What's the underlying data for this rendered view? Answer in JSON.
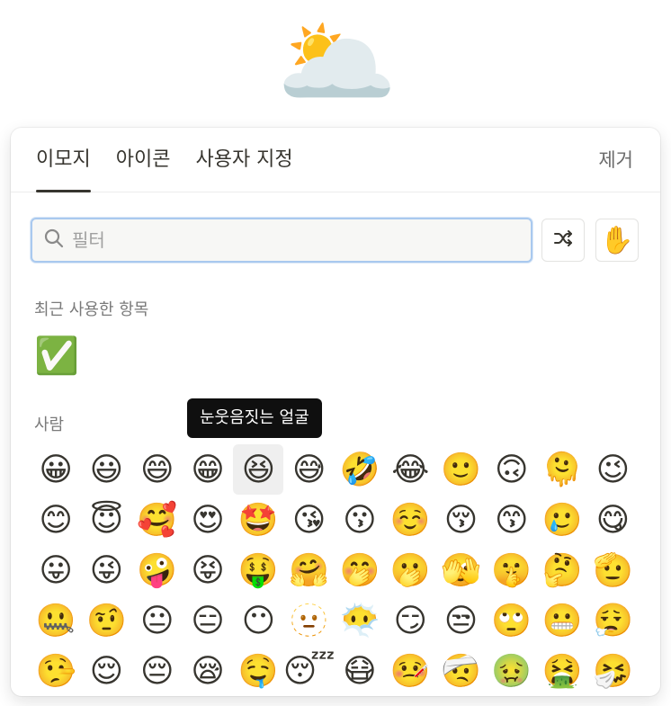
{
  "hero": {
    "emoji": "🌥️"
  },
  "tabs": [
    {
      "label": "이모지",
      "active": true
    },
    {
      "label": "아이콘",
      "active": false
    },
    {
      "label": "사용자 지정",
      "active": false
    }
  ],
  "remove_label": "제거",
  "search": {
    "placeholder": "필터",
    "value": ""
  },
  "buttons": {
    "skin_tone_emoji": "✋",
    "shuffle_icon": "shuffle-icon"
  },
  "recent": {
    "label": "최근 사용한 항목",
    "items": [
      "✅"
    ]
  },
  "people": {
    "label": "사람",
    "emojis": [
      "😀",
      "😃",
      "😄",
      "😁",
      "😆",
      "😅",
      "🤣",
      "😂",
      "🙂",
      "🙃",
      "🫠",
      "😉",
      "😊",
      "😇",
      "🥰",
      "😍",
      "🤩",
      "😘",
      "😗",
      "☺️",
      "😚",
      "😙",
      "🥲",
      "😋",
      "😛",
      "😜",
      "🤪",
      "😝",
      "🤑",
      "🤗",
      "🤭",
      "🫢",
      "🫣",
      "🤫",
      "🤔",
      "🫡",
      "🤐",
      "🤨",
      "😐",
      "😑",
      "😶",
      "🫥",
      "😶‍🌫️",
      "😏",
      "😒",
      "🙄",
      "😬",
      "😮‍💨",
      "🤥",
      "😌",
      "😔",
      "😪",
      "🤤",
      "😴",
      "😷",
      "🤒",
      "🤕",
      "🤢",
      "🤮",
      "🤧"
    ],
    "hovered_index": 4
  },
  "tooltip": "눈웃음짓는 얼굴",
  "colors": {
    "accent_border": "#a9c9ef",
    "text": "#37352f",
    "muted": "#7a7a7a"
  }
}
